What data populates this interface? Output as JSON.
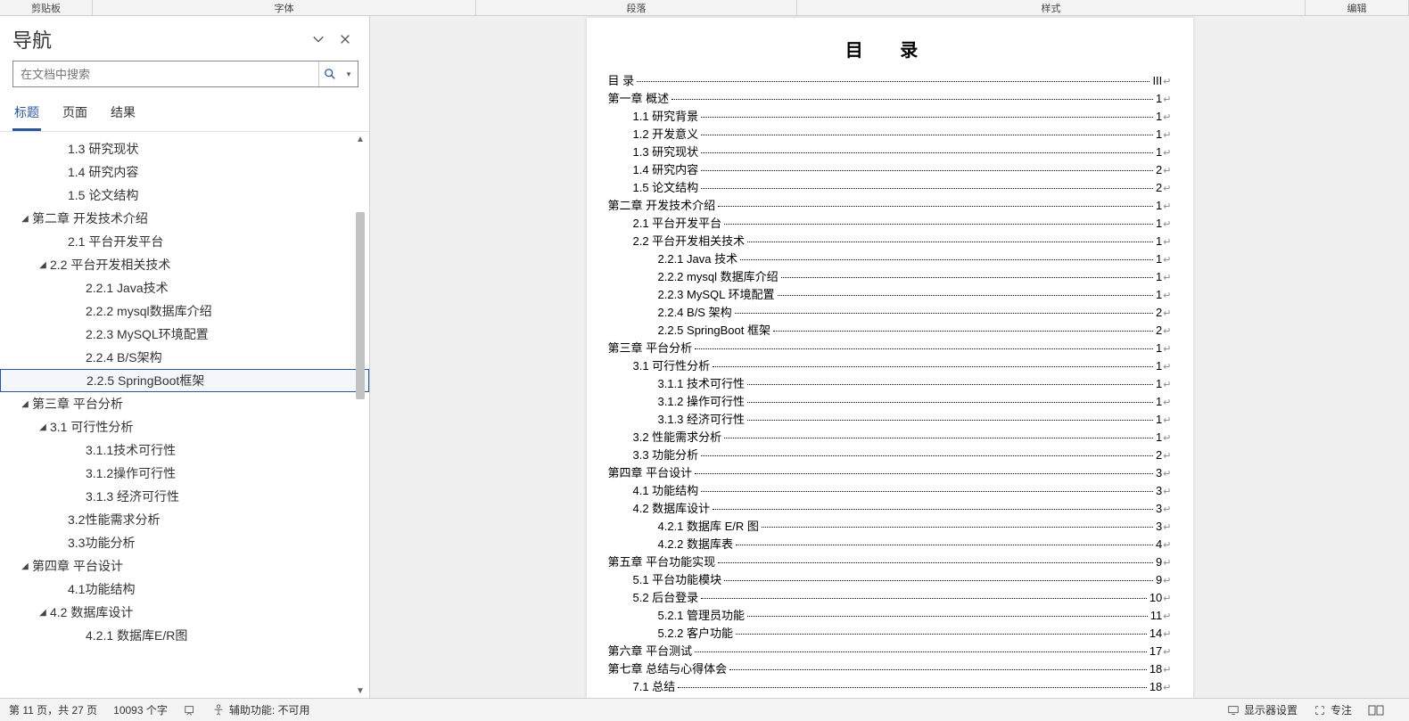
{
  "ribbon": {
    "groups": [
      "剪贴板",
      "字体",
      "段落",
      "样式",
      "编辑"
    ]
  },
  "nav": {
    "title": "导航",
    "search_placeholder": "在文档中搜索",
    "tabs": [
      "标题",
      "页面",
      "结果"
    ],
    "active_tab": 0,
    "selected_index": 10,
    "tree": [
      {
        "indent": 60,
        "chev": "",
        "label": "1.3 研究现状"
      },
      {
        "indent": 60,
        "chev": "",
        "label": "1.4 研究内容"
      },
      {
        "indent": 60,
        "chev": "",
        "label": "1.5 论文结构"
      },
      {
        "indent": 20,
        "chev": "◢",
        "label": "第二章 开发技术介绍"
      },
      {
        "indent": 60,
        "chev": "",
        "label": "2.1 平台开发平台"
      },
      {
        "indent": 40,
        "chev": "◢",
        "label": "2.2 平台开发相关技术"
      },
      {
        "indent": 80,
        "chev": "",
        "label": "2.2.1 Java技术"
      },
      {
        "indent": 80,
        "chev": "",
        "label": "2.2.2 mysql数据库介绍"
      },
      {
        "indent": 80,
        "chev": "",
        "label": "2.2.3 MySQL环境配置"
      },
      {
        "indent": 80,
        "chev": "",
        "label": "2.2.4 B/S架构"
      },
      {
        "indent": 80,
        "chev": "",
        "label": "2.2.5 SpringBoot框架"
      },
      {
        "indent": 20,
        "chev": "◢",
        "label": "第三章 平台分析"
      },
      {
        "indent": 40,
        "chev": "◢",
        "label": "3.1 可行性分析"
      },
      {
        "indent": 80,
        "chev": "",
        "label": "3.1.1技术可行性"
      },
      {
        "indent": 80,
        "chev": "",
        "label": "3.1.2操作可行性"
      },
      {
        "indent": 80,
        "chev": "",
        "label": "3.1.3 经济可行性"
      },
      {
        "indent": 60,
        "chev": "",
        "label": "3.2性能需求分析"
      },
      {
        "indent": 60,
        "chev": "",
        "label": "3.3功能分析"
      },
      {
        "indent": 20,
        "chev": "◢",
        "label": "第四章 平台设计"
      },
      {
        "indent": 60,
        "chev": "",
        "label": "4.1功能结构"
      },
      {
        "indent": 40,
        "chev": "◢",
        "label": "4.2 数据库设计"
      },
      {
        "indent": 80,
        "chev": "",
        "label": "4.2.1 数据库E/R图"
      }
    ]
  },
  "toc": {
    "heading": "目  录",
    "entries": [
      {
        "indent": 0,
        "text": "目  录",
        "page": "III"
      },
      {
        "indent": 0,
        "text": "第一章  概述",
        "page": "1"
      },
      {
        "indent": 28,
        "text": "1.1 研究背景",
        "page": "1"
      },
      {
        "indent": 28,
        "text": "1.2 开发意义",
        "page": "1"
      },
      {
        "indent": 28,
        "text": "1.3 研究现状",
        "page": "1"
      },
      {
        "indent": 28,
        "text": "1.4 研究内容",
        "page": "2"
      },
      {
        "indent": 28,
        "text": "1.5 论文结构",
        "page": "2"
      },
      {
        "indent": 0,
        "text": "第二章  开发技术介绍",
        "page": "1"
      },
      {
        "indent": 28,
        "text": "2.1 平台开发平台",
        "page": "1"
      },
      {
        "indent": 28,
        "text": "2.2 平台开发相关技术",
        "page": "1"
      },
      {
        "indent": 56,
        "text": "2.2.1   Java 技术",
        "page": "1"
      },
      {
        "indent": 56,
        "text": "2.2.2   mysql 数据库介绍",
        "page": "1"
      },
      {
        "indent": 56,
        "text": "2.2.3   MySQL 环境配置",
        "page": "1"
      },
      {
        "indent": 56,
        "text": "2.2.4   B/S 架构",
        "page": "2"
      },
      {
        "indent": 56,
        "text": "2.2.5   SpringBoot 框架",
        "page": "2"
      },
      {
        "indent": 0,
        "text": "第三章  平台分析",
        "page": "1"
      },
      {
        "indent": 28,
        "text": "3.1 可行性分析",
        "page": "1"
      },
      {
        "indent": 56,
        "text": "3.1.1 技术可行性",
        "page": "1"
      },
      {
        "indent": 56,
        "text": "3.1.2 操作可行性",
        "page": "1"
      },
      {
        "indent": 56,
        "text": "3.1.3 经济可行性",
        "page": "1"
      },
      {
        "indent": 28,
        "text": "3.2 性能需求分析",
        "page": "1"
      },
      {
        "indent": 28,
        "text": "3.3 功能分析",
        "page": "2"
      },
      {
        "indent": 0,
        "text": "第四章  平台设计",
        "page": "3"
      },
      {
        "indent": 28,
        "text": "4.1 功能结构",
        "page": "3"
      },
      {
        "indent": 28,
        "text": "4.2 数据库设计",
        "page": "3"
      },
      {
        "indent": 56,
        "text": "4.2.1 数据库 E/R 图",
        "page": "3"
      },
      {
        "indent": 56,
        "text": "4.2.2 数据库表",
        "page": "4"
      },
      {
        "indent": 0,
        "text": "第五章  平台功能实现",
        "page": "9"
      },
      {
        "indent": 28,
        "text": "5.1 平台功能模块",
        "page": "9"
      },
      {
        "indent": 28,
        "text": "5.2 后台登录",
        "page": "10"
      },
      {
        "indent": 56,
        "text": "5.2.1 管理员功能",
        "page": "11"
      },
      {
        "indent": 56,
        "text": "5.2.2 客户功能",
        "page": "14"
      },
      {
        "indent": 0,
        "text": "第六章  平台测试",
        "page": "17"
      },
      {
        "indent": 0,
        "text": "第七章 总结与心得体会",
        "page": "18"
      },
      {
        "indent": 28,
        "text": "7.1 总结",
        "page": "18"
      }
    ]
  },
  "status": {
    "page": "第 11 页，共 27 页",
    "words": "10093 个字",
    "a11y": "辅助功能: 不可用",
    "display": "显示器设置",
    "focus": "专注"
  }
}
